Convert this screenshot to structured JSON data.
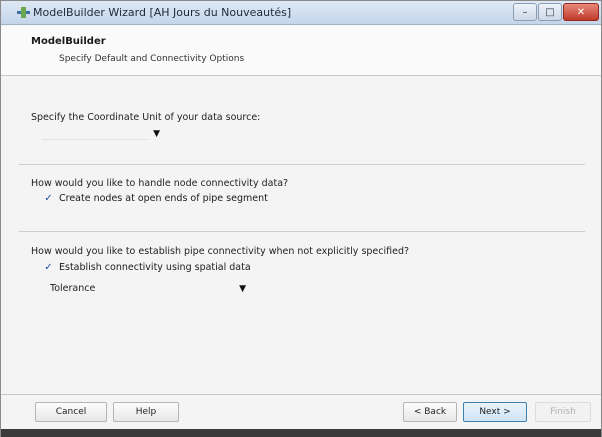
{
  "window": {
    "title": "ModelBuilder Wizard [AH Jours du Nouveautés]",
    "icons": {
      "app": "app-icon",
      "minimize": "minimize-icon",
      "maximize": "maximize-icon",
      "close": "close-icon"
    },
    "minimize_glyph": "–",
    "maximize_glyph": "□",
    "close_glyph": "✕"
  },
  "header": {
    "title": "ModelBuilder",
    "subtitle": "Specify Default and Connectivity Options"
  },
  "unit_section": {
    "prompt": "Specify the Coordinate Unit of your data source:",
    "selected": ""
  },
  "node_section": {
    "prompt": "How would you like to handle node connectivity data?",
    "checkbox_label": "Create nodes at open ends of pipe segment",
    "checked": true
  },
  "connectivity_section": {
    "prompt": "How would you like to establish pipe connectivity when not explicitly specified?",
    "checkbox_label": "Establish connectivity using spatial data",
    "checked": true,
    "method_selected": "Tolerance"
  },
  "glyphs": {
    "check": "✓",
    "dropdown_arrow": "▼"
  },
  "buttons": {
    "cancel": "Cancel",
    "help": "Help",
    "back": "< Back",
    "next": "Next >",
    "finish": "Finish"
  }
}
